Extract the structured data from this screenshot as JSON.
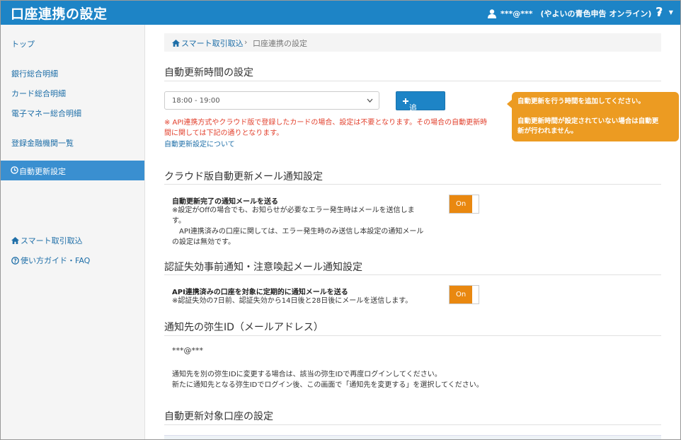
{
  "header": {
    "title": "口座連携の設定",
    "user_label": "***@***　(やよいの青色申告 オンライン)",
    "help_label": "?"
  },
  "sidebar": {
    "items": [
      {
        "label": "トップ"
      },
      {
        "label": "銀行総合明細"
      },
      {
        "label": "カード総合明細"
      },
      {
        "label": "電子マネー総合明細"
      },
      {
        "label": "登録金融機関一覧"
      },
      {
        "label": "自動更新設定"
      },
      {
        "label": "スマート取引取込"
      },
      {
        "label": "使い方ガイド・FAQ"
      }
    ]
  },
  "breadcrumb": {
    "home": "スマート取引取込",
    "separator": "›",
    "current": "口座連携の設定"
  },
  "auto_update_time": {
    "title": "自動更新時間の設定",
    "select_value": "18:00 - 19:00",
    "add_button": "追加する",
    "warning_line1": "※ API連携方式やクラウド版で登録したカードの場合、設定は不要となります。その場合の自動更新時",
    "warning_line2": "間に関しては下記の通りとなります。",
    "link": "自動更新設定について"
  },
  "tooltip": {
    "line1": "自動更新を行う時間を追加してください。",
    "line2a": "自動更新時間が設定されていない場合は自動更",
    "line2b": "新が行われません。"
  },
  "cloud_mail": {
    "title": "クラウド版自動更新メール通知設定",
    "option_title": "自動更新完了の通知メールを送る",
    "desc1": "※設定がOffの場合でも、お知らせが必要なエラー発生時はメールを送信しま",
    "desc2": "す。",
    "desc3": "　API連携済みの口座に関しては、エラー発生時のみ送信し本設定の通知メール",
    "desc4": "の設定は無効です。",
    "toggle_label": "On"
  },
  "auth_mail": {
    "title": "認証失効事前通知・注意喚起メール通知設定",
    "option_title": "API連携済みの口座を対象に定期的に通知メールを送る",
    "desc1": "※認証失効の7日前、認証失効から14日後と28日後にメールを送信します。",
    "toggle_label": "On"
  },
  "notify_id": {
    "title": "通知先の弥生ID（メールアドレス）",
    "value": "***@***",
    "para1": "通知先を別の弥生IDに変更する場合は、該当の弥生IDで再度ログインしてください。",
    "para2": "新たに通知先となる弥生IDでログイン後、この画面で「通知先を変更する」を選択してください。"
  },
  "target_accounts": {
    "title": "自動更新対象口座の設定"
  },
  "colors": {
    "header_bg": "#1d84c6",
    "accent_orange": "#e98810",
    "tooltip_bg": "#ec9b22",
    "warning_text": "#e2402d",
    "link": "#1f6fa8"
  }
}
